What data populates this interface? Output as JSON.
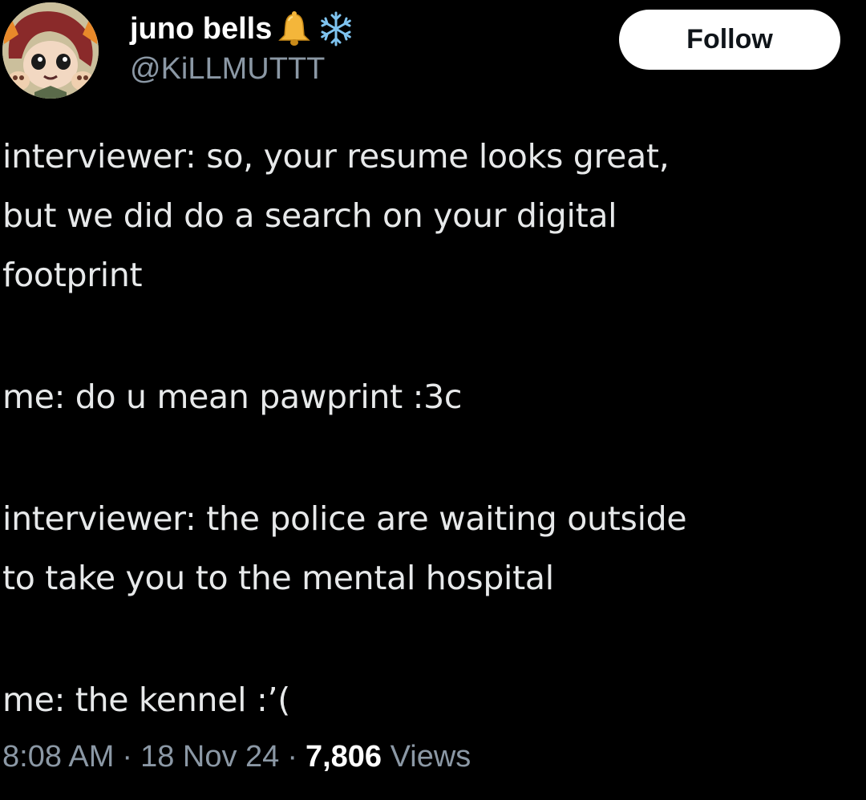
{
  "author": {
    "display_name": "juno bells",
    "handle": "@KiLLMUTTT",
    "name_emojis": [
      "bell-icon",
      "snowflake-icon"
    ],
    "avatar": "avatar"
  },
  "follow_button": {
    "label": "Follow"
  },
  "tweet": {
    "lines": [
      "interviewer: so, your resume looks great,",
      "but we did do a search on your digital",
      "footprint",
      "me: do u mean pawprint :3c",
      "interviewer: the police are waiting outside",
      "to take you to the mental hospital",
      "me: the kennel :’("
    ]
  },
  "meta": {
    "time": "8:08 AM",
    "separator": "·",
    "date": "18 Nov 24",
    "views_count": "7,806",
    "views_label": "Views"
  },
  "colors": {
    "background": "#000000",
    "text_primary": "#e7e9ea",
    "text_secondary": "#8b98a5",
    "button_bg": "#ffffff",
    "button_text": "#0f1419"
  }
}
